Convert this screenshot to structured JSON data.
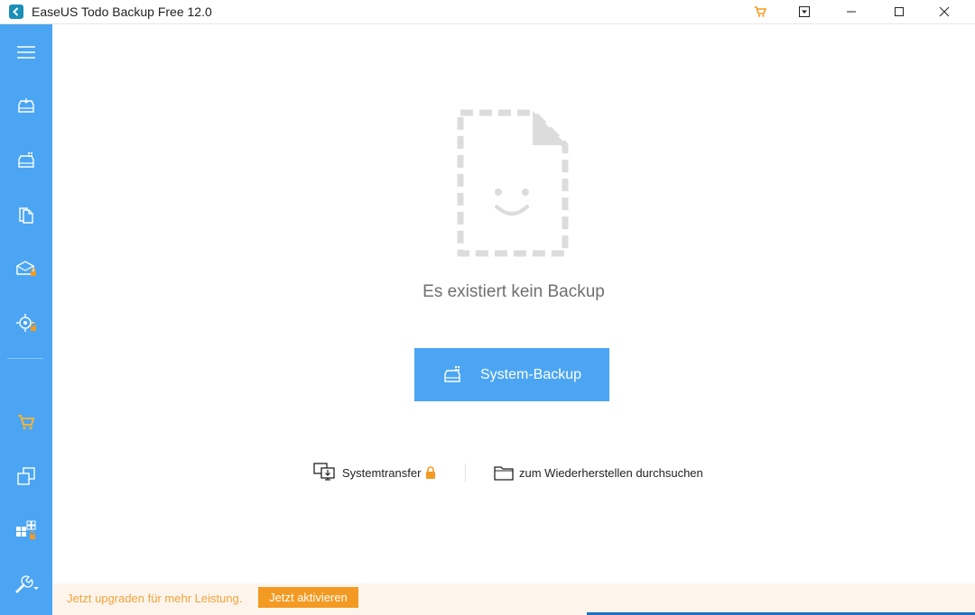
{
  "window": {
    "title": "EaseUS Todo Backup Free 12.0",
    "controls": [
      "cart-icon",
      "dropdown-icon",
      "minimize-icon",
      "maximize-icon",
      "close-icon"
    ]
  },
  "sidebar": {
    "items": [
      {
        "name": "menu",
        "icon": "hamburger-icon"
      },
      {
        "name": "disk-backup",
        "icon": "disk-backup-icon"
      },
      {
        "name": "system-backup",
        "icon": "system-backup-icon"
      },
      {
        "name": "file-backup",
        "icon": "file-backup-icon"
      },
      {
        "name": "mail-backup",
        "icon": "mail-locked-icon"
      },
      {
        "name": "smart-backup",
        "icon": "target-locked-icon"
      },
      {
        "name": "shop",
        "icon": "cart-icon"
      },
      {
        "name": "clone",
        "icon": "clone-icon"
      },
      {
        "name": "system-clone",
        "icon": "windows-locked-icon"
      },
      {
        "name": "tools",
        "icon": "wrench-icon"
      }
    ]
  },
  "main": {
    "empty_message": "Es existiert kein Backup",
    "primary_button": {
      "label": "System-Backup",
      "icon": "system-backup-icon"
    },
    "links": {
      "transfer": {
        "label": "Systemtransfer",
        "icon": "transfer-icon",
        "badge": "lock-icon"
      },
      "browse": {
        "label": "zum Wiederherstellen durchsuchen",
        "icon": "folder-icon"
      }
    }
  },
  "banner": {
    "text": "Jetzt upgraden für mehr Leistung.",
    "button": "Jetzt aktivieren"
  },
  "colors": {
    "sidebar": "#4ba5f3",
    "primary": "#4ba5f3",
    "accent": "#f39a22"
  }
}
